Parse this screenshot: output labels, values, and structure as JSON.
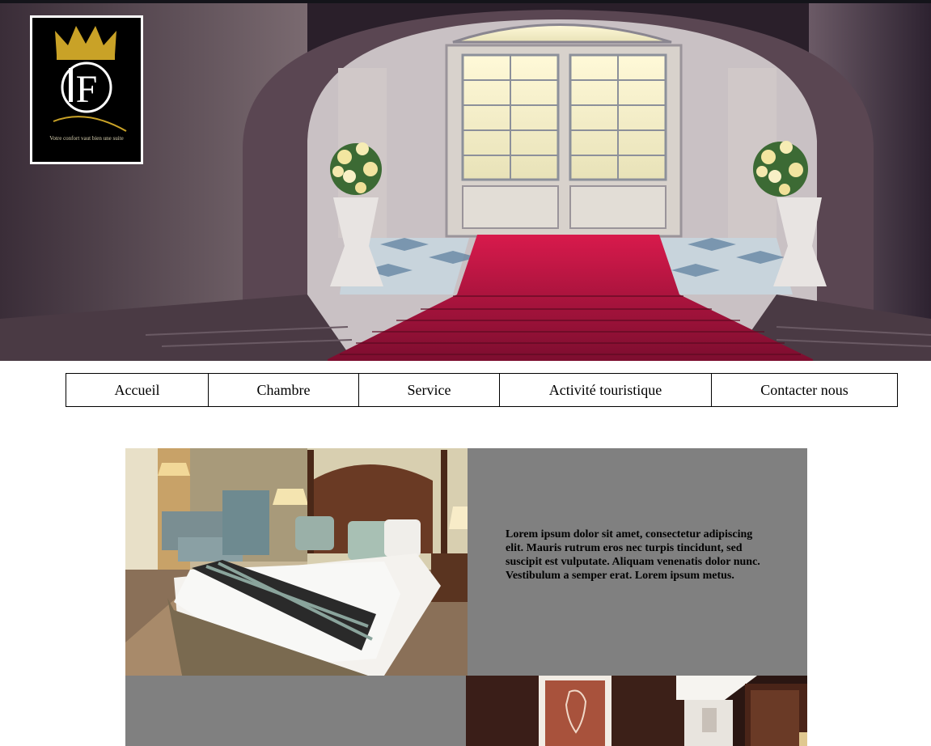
{
  "logo": {
    "monogram": "F",
    "tagline": "Votre confort vaut bien une suite"
  },
  "nav": {
    "items": [
      {
        "label": "Accueil"
      },
      {
        "label": "Chambre"
      },
      {
        "label": "Service"
      },
      {
        "label": "Activité touristique"
      },
      {
        "label": "Contacter nous"
      }
    ]
  },
  "content": {
    "intro_text": "Lorem ipsum dolor sit amet, consectetur adipiscing elit. Mauris rutrum eros nec turpis tincidunt, sed suscipit est vulputate. Aliquam venenatis dolor nunc. Vestibulum a semper erat. Lorem ipsum metus."
  },
  "colors": {
    "carpet": "#c8123e",
    "panel_gray": "#808080",
    "logo_gold": "#c9a227"
  }
}
